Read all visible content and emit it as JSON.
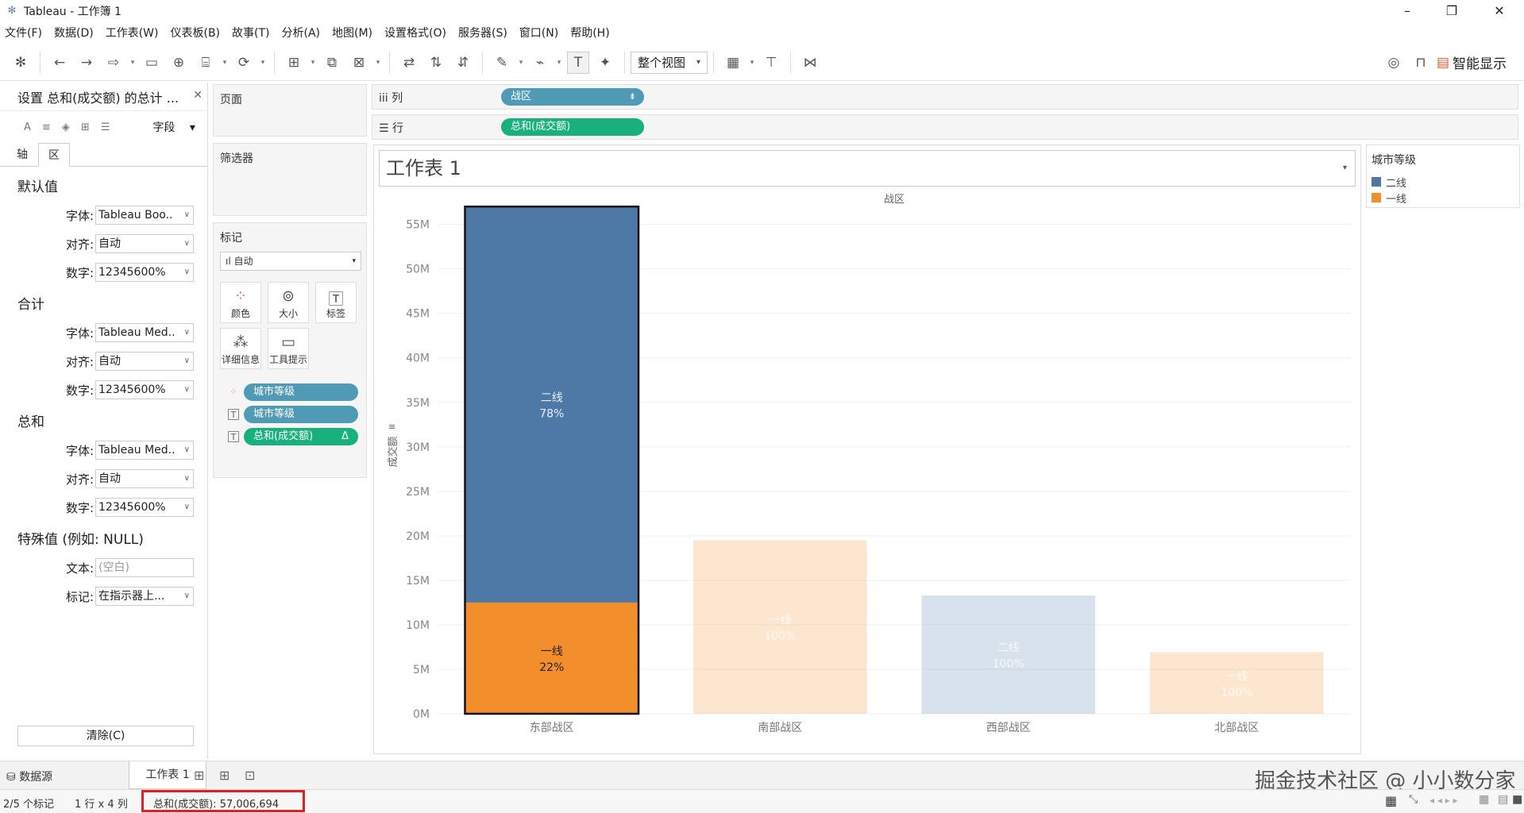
{
  "window": {
    "title": "Tableau - 工作簿 1"
  },
  "menu": [
    "文件(F)",
    "数据(D)",
    "工作表(W)",
    "仪表板(B)",
    "故事(T)",
    "分析(A)",
    "地图(M)",
    "设置格式(O)",
    "服务器(S)",
    "窗口(N)",
    "帮助(H)"
  ],
  "toolbar": {
    "fit_select": "整个视图",
    "show_me": "智能显示"
  },
  "format_panel": {
    "title": "设置 总和(成交额) 的总计 ...",
    "fields_label": "字段",
    "tabs": [
      "轴",
      "区"
    ],
    "sections": [
      {
        "title": "默认值",
        "rows": [
          {
            "label": "字体:",
            "value": "Tableau Boo.."
          },
          {
            "label": "对齐:",
            "value": "自动"
          },
          {
            "label": "数字:",
            "value": "12345600%"
          }
        ]
      },
      {
        "title": "合计",
        "rows": [
          {
            "label": "字体:",
            "value": "Tableau Med.."
          },
          {
            "label": "对齐:",
            "value": "自动"
          },
          {
            "label": "数字:",
            "value": "12345600%"
          }
        ]
      },
      {
        "title": "总和",
        "rows": [
          {
            "label": "字体:",
            "value": "Tableau Med.."
          },
          {
            "label": "对齐:",
            "value": "自动"
          },
          {
            "label": "数字:",
            "value": "12345600%"
          }
        ]
      },
      {
        "title": "特殊值 (例如: NULL)",
        "rows": [
          {
            "label": "文本:",
            "value": "(空白)"
          },
          {
            "label": "标记:",
            "value": "在指示器上..."
          }
        ]
      }
    ],
    "clear_button": "清除(C)"
  },
  "cards": {
    "pages": "页面",
    "filters": "筛选器",
    "marks": {
      "title": "标记",
      "type": "自动",
      "buttons": [
        "颜色",
        "大小",
        "标签",
        "详细信息",
        "工具提示"
      ],
      "pills": [
        "城市等级",
        "城市等级",
        "总和(成交额)"
      ]
    }
  },
  "shelves": {
    "columns_label": "列",
    "columns_pill": "战区",
    "rows_label": "行",
    "rows_pill": "总和(成交额)"
  },
  "sheet": {
    "title": "工作表 1"
  },
  "legend": {
    "title": "城市等级",
    "items": [
      {
        "label": "二线",
        "color": "#4e79a7"
      },
      {
        "label": "一线",
        "color": "#f28e2b"
      }
    ]
  },
  "chart_data": {
    "type": "bar",
    "stacked": true,
    "xlabel": "战区",
    "ylabel": "成交额",
    "ylim": [
      0,
      58
    ],
    "y_ticks": [
      "0M",
      "5M",
      "10M",
      "15M",
      "20M",
      "25M",
      "30M",
      "35M",
      "40M",
      "45M",
      "50M",
      "55M"
    ],
    "categories": [
      "东部战区",
      "南部战区",
      "西部战区",
      "北部战区"
    ],
    "segments": [
      {
        "category": "东部战区",
        "level": "一线",
        "value": 12.5,
        "label": "一线",
        "pct": "22%",
        "color": "#f28e2b",
        "dim": false
      },
      {
        "category": "东部战区",
        "level": "二线",
        "value": 44.5,
        "label": "二线",
        "pct": "78%",
        "color": "#4e79a7",
        "dim": false
      },
      {
        "category": "南部战区",
        "level": "一线",
        "value": 19.5,
        "label": "一线",
        "pct": "100%",
        "color": "#f28e2b",
        "dim": true
      },
      {
        "category": "西部战区",
        "level": "二线",
        "value": 13.3,
        "label": "二线",
        "pct": "100%",
        "color": "#4e79a7",
        "dim": true
      },
      {
        "category": "北部战区",
        "level": "一线",
        "value": 6.9,
        "label": "一线",
        "pct": "100%",
        "color": "#f28e2b",
        "dim": true
      }
    ]
  },
  "bottom_tabs": {
    "datasource": "数据源",
    "sheet": "工作表 1"
  },
  "status": {
    "marks": "2/5 个标记",
    "dims": "1 行 x 4 列",
    "sum": "总和(成交额): 57,006,694"
  },
  "watermark": "掘金技术社区 @ 小小数分家"
}
